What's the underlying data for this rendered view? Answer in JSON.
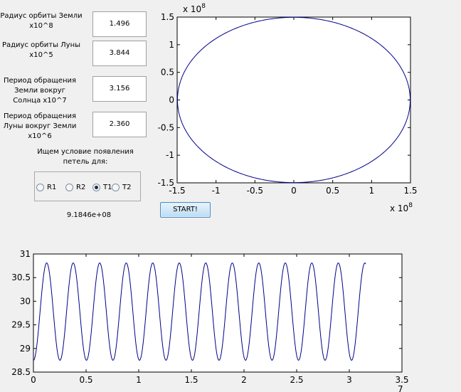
{
  "form": {
    "earth_radius": {
      "label_line1": "Радиус орбиты Земли",
      "label_line2": "x10^8",
      "value": "1.496"
    },
    "moon_radius": {
      "label_line1": "Радиус орбиты Луны",
      "label_line2": "x10^5",
      "value": "3.844"
    },
    "earth_period": {
      "label_line1": "Период обращения",
      "label_line2": "Земли вокруг",
      "label_line3": "Солнца x10^7",
      "value": "3.156"
    },
    "moon_period": {
      "label_line1": "Период обращения",
      "label_line2": "Луны вокруг Земли",
      "label_line3": "x10^6",
      "value": "2.360"
    }
  },
  "condition": {
    "heading_line1": "Ищем условие появления",
    "heading_line2": "петель для:",
    "options": [
      "R1",
      "R2",
      "T1",
      "T2"
    ],
    "selected": "T1"
  },
  "start_button": "START!",
  "result_text": "9.1846e+08",
  "colors": {
    "line": "#00008b",
    "window_bg": "#f0f0f0"
  },
  "chart_data": [
    {
      "type": "line",
      "title": "",
      "xlabel": "",
      "ylabel": "",
      "x_exponent": "x 10",
      "x_exponent_power": "8",
      "y_exponent": "x 10",
      "y_exponent_power": "8",
      "xlim": [
        -1.5,
        1.5
      ],
      "ylim": [
        -1.5,
        1.5
      ],
      "x_ticks": [
        "-1.5",
        "-1",
        "-0.5",
        "0",
        "0.5",
        "1",
        "1.5"
      ],
      "y_ticks": [
        "1.5",
        "1",
        "0.5",
        "0",
        "-0.5",
        "-1",
        "-1.5"
      ],
      "series": [
        {
          "shape": "circle",
          "center": [
            0,
            0
          ],
          "radius": 1.496
        }
      ]
    },
    {
      "type": "line",
      "title": "",
      "xlabel": "",
      "ylabel": "",
      "x_exponent_power": "7",
      "xlim": [
        0,
        3.5
      ],
      "ylim": [
        28.5,
        31
      ],
      "x_ticks": [
        "0",
        "0.5",
        "1",
        "1.5",
        "2",
        "2.5",
        "3",
        "3.5"
      ],
      "y_ticks": [
        "31",
        "30.5",
        "30",
        "29.5",
        "29",
        "28.5"
      ],
      "series": [
        {
          "shape": "sinusoid",
          "x_end": 3.156,
          "y_mean": 29.78,
          "amplitude": 1.03,
          "period": 0.2518,
          "phase_start": "minimum"
        }
      ]
    }
  ]
}
